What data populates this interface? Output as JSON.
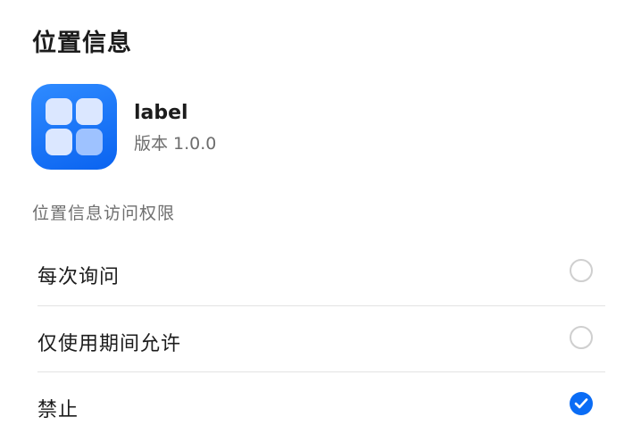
{
  "dialog": {
    "title": "位置信息"
  },
  "app": {
    "icon": "app-grid-icon",
    "name": "label",
    "version": "版本 1.0.0"
  },
  "permission": {
    "section_label": "位置信息访问权限",
    "options": [
      {
        "label": "每次询问",
        "selected": false
      },
      {
        "label": "仅使用期间允许",
        "selected": false
      },
      {
        "label": "禁止",
        "selected": true
      }
    ]
  },
  "colors": {
    "accent": "#0a6cf5",
    "icon_gradient_top": "#2f8bff",
    "icon_gradient_bottom": "#0a63f0"
  }
}
